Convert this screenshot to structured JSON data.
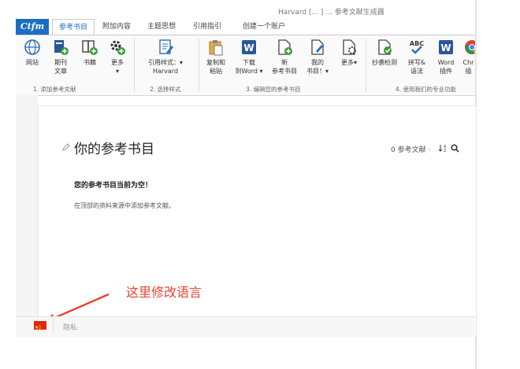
{
  "window": {
    "title": "Harvard [... ] ... 参考文献生成器"
  },
  "logo": "Ctfm",
  "tabs": [
    {
      "label": "参考书目",
      "active": true
    },
    {
      "label": "附加内容"
    },
    {
      "label": "主题思想"
    },
    {
      "label": "引用指引"
    },
    {
      "label": "创建一个账户"
    }
  ],
  "ribbon": {
    "buttons": {
      "website": "网站",
      "journal": "期刊\n文章",
      "book": "书籍",
      "more1": "更多\n▾",
      "citation_style": "引用样式：▾\nHarvard",
      "copy_paste": "复制和\n粘贴",
      "download_word": "下载\n到Word ▾",
      "new_bib": "新\n参考书目",
      "my_bib": "我的\n书目！▾",
      "more2": "更多▾",
      "plagiarism": "抄袭检测",
      "spelling": "拼写&\n语法",
      "word_addin": "Word\n插件",
      "chrome": "Chr\n插"
    },
    "groups": {
      "g1": "1. 添加参考文献",
      "g2": "2. 选择样式",
      "g3": "3. 编辑您的参考书目",
      "g4": "4. 使用我们的专业功能"
    }
  },
  "document": {
    "title": "你的参考书目",
    "ref_count": "0 参考文献 ·",
    "empty_title": "您的参考书目当前为空！",
    "empty_hint": "在顶部的资料来源中添加参考文献。"
  },
  "annotation": {
    "text": "这里修改语言",
    "color": "#e8432f"
  },
  "footer": {
    "privacy": "隐私",
    "language_flag": "china-flag-icon"
  },
  "colors": {
    "accent": "#1b6ec2",
    "word_blue": "#2b579a",
    "annotation_red": "#e8432f"
  }
}
